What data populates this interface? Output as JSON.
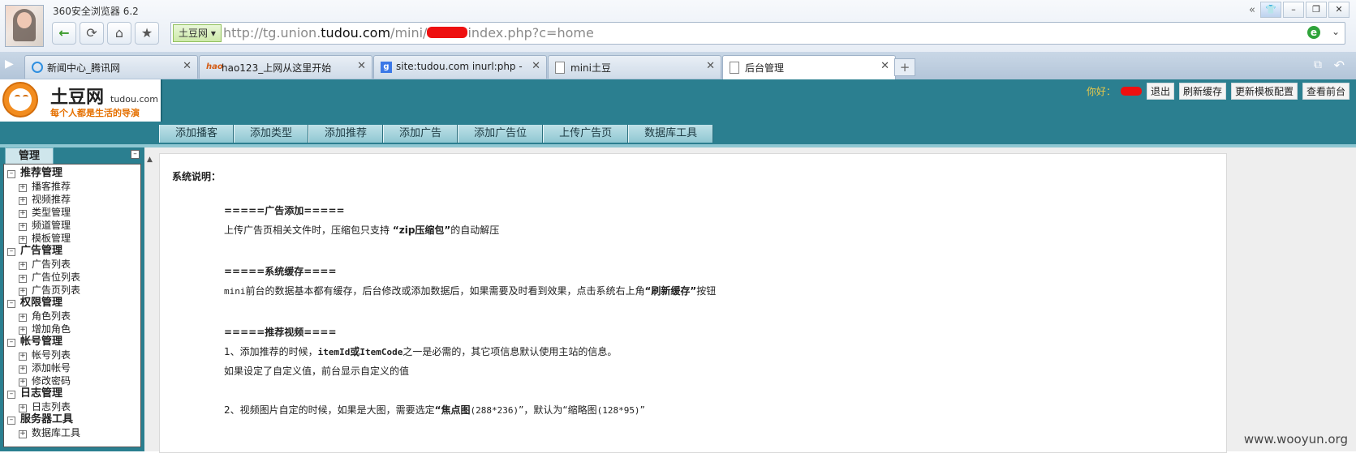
{
  "browser": {
    "title": "360安全浏览器 6.2",
    "site_tag": "土豆网",
    "url": {
      "prefix": "http://tg.union.",
      "domain": "tudou.com",
      "mid": "/mini/",
      "suffix": "index.php?c=home"
    },
    "window_controls": {
      "skin": "👕",
      "minimize": "–",
      "restore": "❐",
      "close": "✕",
      "collapse": "«"
    },
    "tabs": [
      {
        "label": "新闻中心_腾讯网",
        "icon": "qq-icon",
        "active": false
      },
      {
        "label": "hao123_上网从这里开始",
        "icon": "hao123-icon",
        "active": false
      },
      {
        "label": "site:tudou.com inurl:php - G",
        "icon": "google-icon",
        "active": false
      },
      {
        "label": "mini土豆",
        "icon": "page-icon",
        "active": false
      },
      {
        "label": "后台管理",
        "icon": "page-icon",
        "active": true
      }
    ]
  },
  "header": {
    "logo_name": "土豆网",
    "logo_domain": "tudou.com",
    "logo_slogan": "每个人都是生活的导演",
    "greeting": "你好：",
    "links": [
      "退出",
      "刷新缓存",
      "更新模板配置",
      "查看前台"
    ]
  },
  "menu": [
    "添加播客",
    "添加类型",
    "添加推荐",
    "添加广告",
    "添加广告位",
    "上传广告页",
    "数据库工具"
  ],
  "sidebar": {
    "tab": "管理",
    "groups": [
      {
        "label": "推荐管理",
        "items": [
          "播客推荐",
          "视频推荐",
          "类型管理",
          "频道管理",
          "模板管理"
        ]
      },
      {
        "label": "广告管理",
        "items": [
          "广告列表",
          "广告位列表",
          "广告页列表"
        ]
      },
      {
        "label": "权限管理",
        "items": [
          "角色列表",
          "增加角色"
        ]
      },
      {
        "label": "帐号管理",
        "items": [
          "帐号列表",
          "添加帐号",
          "修改密码"
        ]
      },
      {
        "label": "日志管理",
        "items": [
          "日志列表"
        ]
      },
      {
        "label": "服务器工具",
        "items": [
          "数据库工具"
        ]
      }
    ]
  },
  "content": {
    "title": "系统说明：",
    "s1_head": "=====广告添加=====",
    "s1_a": "上传广告页相关文件时，压缩包只支持 ",
    "s1_b": "“zip压缩包”",
    "s1_c": "的自动解压",
    "s2_head": "=====系统缓存====",
    "s2_a": "mini",
    "s2_b": "前台的数据基本都有缓存，后台修改或添加数据后，如果需要及时看到效果，点击系统右上角",
    "s2_c": "“刷新缓存”",
    "s2_d": "按钮",
    "s3_head": "=====推荐视频====",
    "s3_l1a": "1、添加推荐的时候，",
    "s3_l1b": "itemId",
    "s3_l1c": "或",
    "s3_l1d": "ItemCode",
    "s3_l1e": "之一是必需的，其它项信息默认使用主站的信息。",
    "s3_l2": "如果设定了自定义值，前台显示自定义的值",
    "s3_l3a": "2、视频图片自定的时候，如果是大图，需要选定",
    "s3_l3b": "“焦点图",
    "s3_l3c": "(288*236)",
    "s3_l3d": "”，默认为“缩略图",
    "s3_l3e": "(128*95)",
    "s3_l3f": "”"
  },
  "watermark": "www.wooyun.org"
}
